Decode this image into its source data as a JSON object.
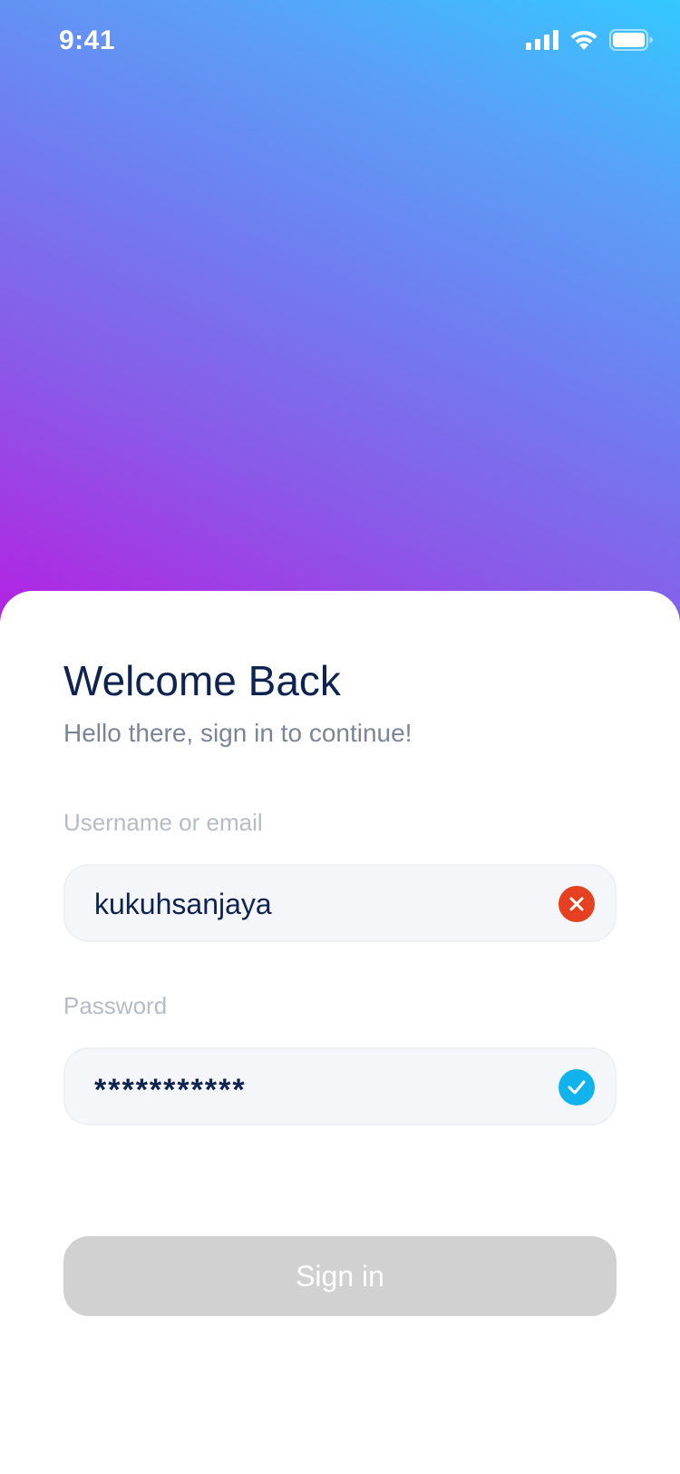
{
  "status_bar": {
    "time": "9:41",
    "icons": [
      "cellular-signal-icon",
      "wifi-icon",
      "battery-icon"
    ]
  },
  "login": {
    "title": "Welcome Back",
    "subtitle": "Hello there, sign in to continue!",
    "username": {
      "label": "Username or email",
      "value": "kukuhsanjaya",
      "icon": "clear-icon",
      "icon_color": "#e5401f"
    },
    "password": {
      "label": "Password",
      "value": "***********",
      "icon": "checkmark-icon",
      "icon_color": "#10b3eb"
    },
    "sign_in_label": "Sign in"
  },
  "colors": {
    "gradient_top_right": "#34c8ff",
    "gradient_bottom_left": "#b51fe2",
    "heading": "#0f2350",
    "button_disabled": "#d1d1d1"
  }
}
